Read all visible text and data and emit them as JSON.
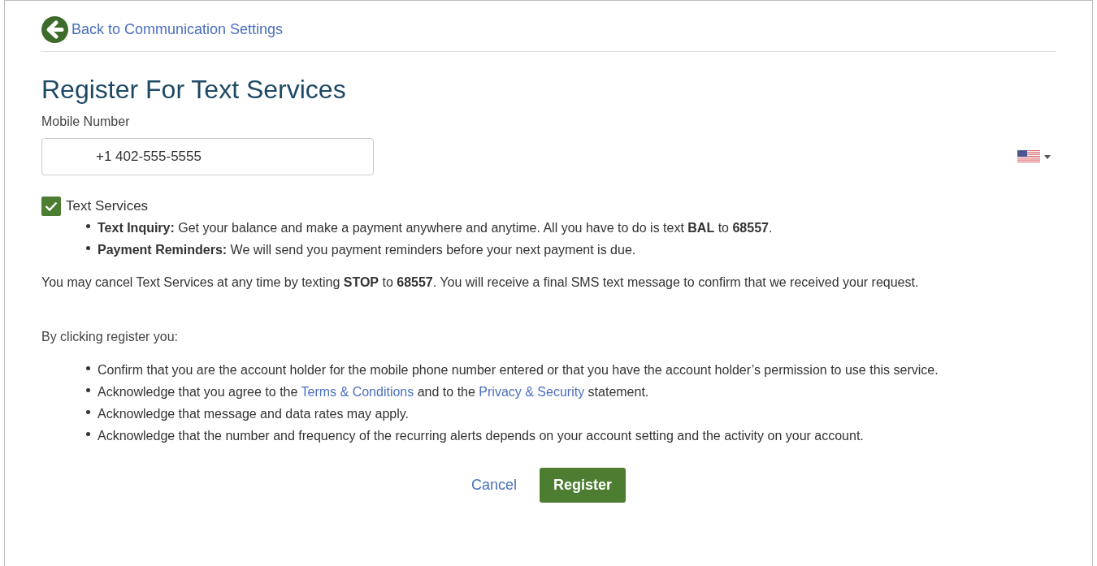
{
  "back_link": "Back to Communication Settings",
  "title": "Register For Text Services",
  "mobile_field": {
    "label": "Mobile Number",
    "value": "+1 402-555-5555"
  },
  "text_services": {
    "label": "Text Services",
    "checked": true,
    "items": [
      {
        "text": "**Text Inquiry:** Get your balance and make a payment anywhere and anytime. All you have to do is text **BAL** to **68557**."
      },
      {
        "text": "**Payment Reminders:** We will send you payment reminders before your next payment is due."
      }
    ]
  },
  "cancel_note": "You may cancel Text Services at any time by texting **STOP** to **68557**. You will receive a final SMS text message to confirm that we received your request.",
  "consent": {
    "intro": "By clicking register you:",
    "items": [
      [
        {
          "kind": "text",
          "text": "Confirm that you are the account holder for the mobile phone number entered or that you have the account holder’s permission to use this service."
        }
      ],
      [
        {
          "kind": "text",
          "text": "Acknowledge that you agree to the "
        },
        {
          "kind": "link",
          "text": "Terms & Conditions"
        },
        {
          "kind": "text",
          "text": " and to the "
        },
        {
          "kind": "link",
          "text": "Privacy & Security"
        },
        {
          "kind": "text",
          "text": " statement."
        }
      ],
      [
        {
          "kind": "text",
          "text": "Acknowledge that message and data rates may apply."
        }
      ],
      [
        {
          "kind": "text",
          "text": "Acknowledge that the number and frequency of the recurring alerts depends on your account setting and the activity on your account."
        }
      ]
    ]
  },
  "buttons": {
    "cancel": "Cancel",
    "register": "Register"
  }
}
